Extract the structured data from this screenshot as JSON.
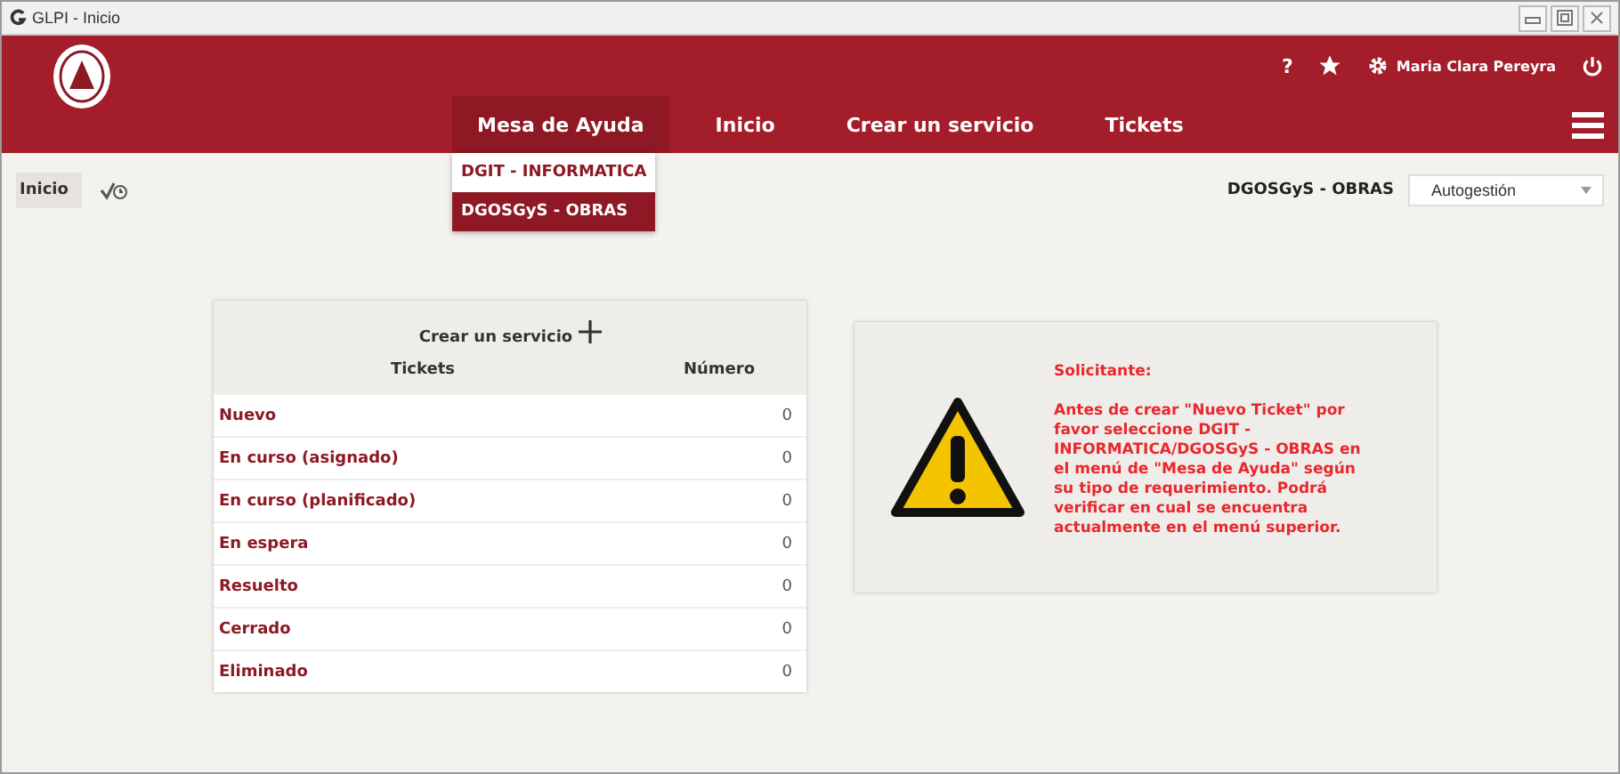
{
  "window": {
    "title": "GLPI - Inicio"
  },
  "header": {
    "user": "Maria Clara Pereyra",
    "help": "?"
  },
  "nav": [
    {
      "label": "Mesa de Ayuda",
      "selected": true
    },
    {
      "label": "Inicio",
      "selected": false
    },
    {
      "label": "Crear un servicio",
      "selected": false
    },
    {
      "label": "Tickets",
      "selected": false
    }
  ],
  "dropdown": [
    {
      "label": "DGIT - INFORMATICA",
      "selected": false
    },
    {
      "label": "DGOSGyS - OBRAS",
      "selected": true
    }
  ],
  "breadcrumb": {
    "label": "Inicio"
  },
  "entity": {
    "label": "DGOSGyS - OBRAS",
    "profile": "Autogestión"
  },
  "tickets_card": {
    "title": "Crear un servicio",
    "columns": [
      "Tickets",
      "Número"
    ],
    "rows": [
      {
        "label": "Nuevo",
        "count": "0"
      },
      {
        "label": "En curso (asignado)",
        "count": "0"
      },
      {
        "label": "En curso (planificado)",
        "count": "0"
      },
      {
        "label": "En espera",
        "count": "0"
      },
      {
        "label": "Resuelto",
        "count": "0"
      },
      {
        "label": "Cerrado",
        "count": "0"
      },
      {
        "label": "Eliminado",
        "count": "0"
      }
    ]
  },
  "notice": {
    "heading": "Solicitante:",
    "text": "Antes de crear \"Nuevo Ticket\" por favor seleccione DGIT - INFORMATICA/DGOSGyS - OBRAS en el menú de \"Mesa de Ayuda\" según su tipo de requerimiento. Podrá verificar en cual se encuentra actualmente en el menú superior."
  }
}
